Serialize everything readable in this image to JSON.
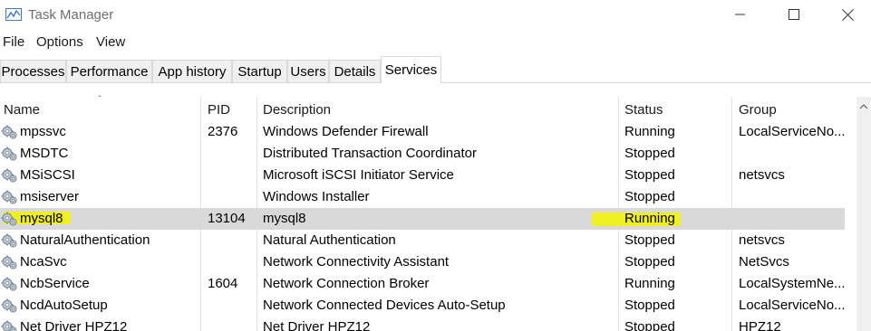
{
  "window": {
    "title": "Task Manager",
    "minimize_icon": "minimize-icon",
    "maximize_icon": "maximize-icon",
    "close_icon": "close-icon"
  },
  "menu": {
    "items": [
      "File",
      "Options",
      "View"
    ]
  },
  "tabs": [
    {
      "label": "Processes",
      "active": false
    },
    {
      "label": "Performance",
      "active": false
    },
    {
      "label": "App history",
      "active": false
    },
    {
      "label": "Startup",
      "active": false
    },
    {
      "label": "Users",
      "active": false
    },
    {
      "label": "Details",
      "active": false
    },
    {
      "label": "Services",
      "active": true
    }
  ],
  "table": {
    "columns": {
      "name": "Name",
      "pid": "PID",
      "description": "Description",
      "status": "Status",
      "group": "Group"
    },
    "sort": {
      "column": "Name",
      "direction": "ascending"
    },
    "rows": [
      {
        "name": "mpssvc",
        "pid": "2376",
        "description": "Windows Defender Firewall",
        "status": "Running",
        "group": "LocalServiceNo..."
      },
      {
        "name": "MSDTC",
        "pid": "",
        "description": "Distributed Transaction Coordinator",
        "status": "Stopped",
        "group": ""
      },
      {
        "name": "MSiSCSI",
        "pid": "",
        "description": "Microsoft iSCSI Initiator Service",
        "status": "Stopped",
        "group": "netsvcs"
      },
      {
        "name": "msiserver",
        "pid": "",
        "description": "Windows Installer",
        "status": "Stopped",
        "group": ""
      },
      {
        "name": "mysql8",
        "pid": "13104",
        "description": "mysql8",
        "status": "Running",
        "group": "",
        "selected": true
      },
      {
        "name": "NaturalAuthentication",
        "pid": "",
        "description": "Natural Authentication",
        "status": "Stopped",
        "group": "netsvcs"
      },
      {
        "name": "NcaSvc",
        "pid": "",
        "description": "Network Connectivity Assistant",
        "status": "Stopped",
        "group": "NetSvcs"
      },
      {
        "name": "NcbService",
        "pid": "1604",
        "description": "Network Connection Broker",
        "status": "Running",
        "group": "LocalSystemNe..."
      },
      {
        "name": "NcdAutoSetup",
        "pid": "",
        "description": "Network Connected Devices Auto-Setup",
        "status": "Stopped",
        "group": "LocalServiceNo..."
      },
      {
        "name": "Net Driver HPZ12",
        "pid": "",
        "description": "Net Driver HPZ12",
        "status": "Stopped",
        "group": "HPZ12"
      }
    ]
  },
  "colors": {
    "selected_row": "#d9d9d9",
    "highlight": "#f2f200",
    "title_text": "#6e6e6e"
  },
  "icons": {
    "service": "service-gear-icon",
    "app": "task-manager-icon"
  }
}
